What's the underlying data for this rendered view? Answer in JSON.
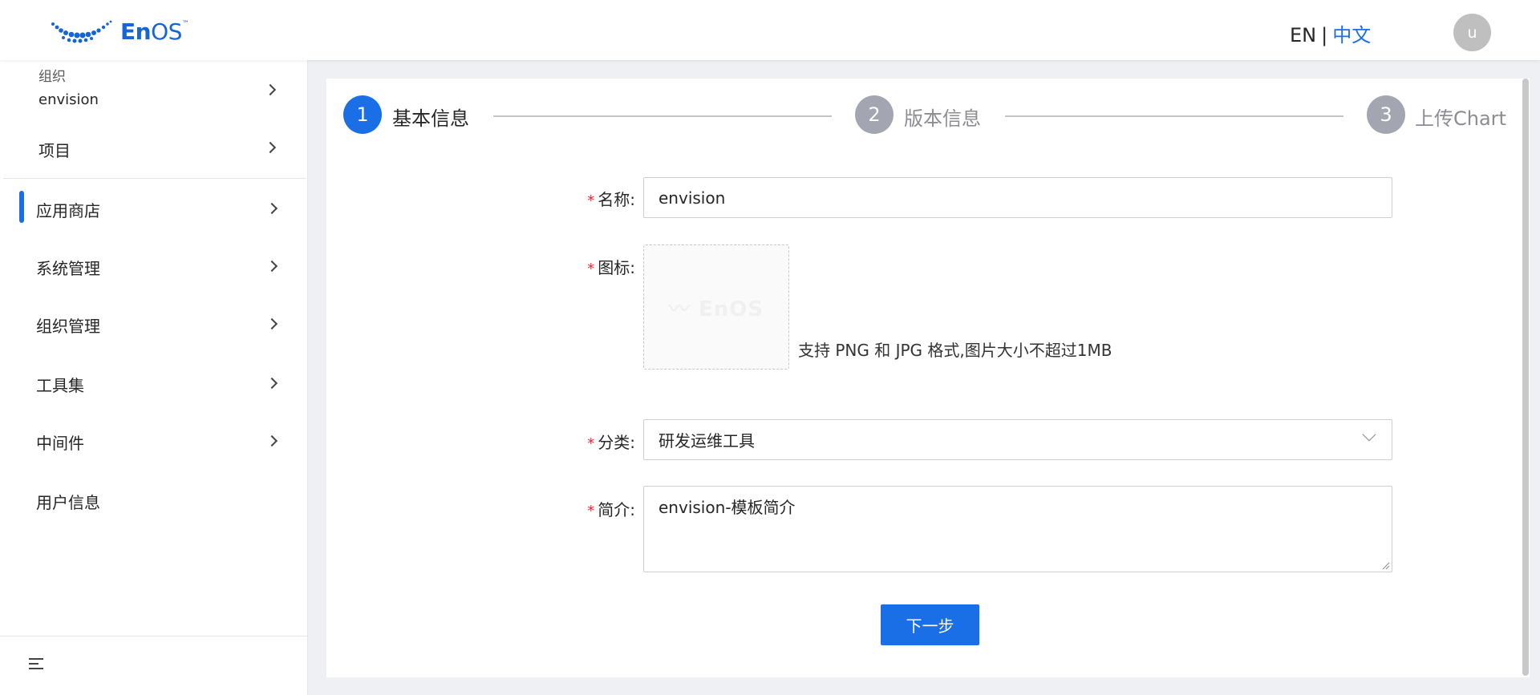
{
  "header": {
    "logo_text_bold": "En",
    "logo_text_regular": "OS",
    "logo_tm": "™",
    "lang_en": "EN",
    "lang_sep": "|",
    "lang_zh": "中文",
    "avatar_letter": "u"
  },
  "sidebar": {
    "org_caption": "组织",
    "org_name": "envision",
    "project_label": "项目",
    "items": [
      {
        "label": "应用商店",
        "active": true,
        "has_arrow": true
      },
      {
        "label": "系统管理",
        "active": false,
        "has_arrow": true
      },
      {
        "label": "组织管理",
        "active": false,
        "has_arrow": true
      },
      {
        "label": "工具集",
        "active": false,
        "has_arrow": true
      },
      {
        "label": "中间件",
        "active": false,
        "has_arrow": true
      },
      {
        "label": "用户信息",
        "active": false,
        "has_arrow": false
      }
    ],
    "collapse_icon": "menu-collapse-icon"
  },
  "steps": [
    {
      "number": "1",
      "label": "基本信息",
      "state": "active"
    },
    {
      "number": "2",
      "label": "版本信息",
      "state": "idle"
    },
    {
      "number": "3",
      "label": "上传Chart",
      "state": "idle"
    }
  ],
  "form": {
    "required_mark": "*",
    "name_label": "名称:",
    "name_value": "envision",
    "icon_label": "图标:",
    "icon_hint": "支持 PNG 和 JPG 格式,图片大小不超过1MB",
    "category_label": "分类:",
    "category_value": "研发运维工具",
    "intro_label": "简介:",
    "intro_value": "envision-模板简介",
    "next_button": "下一步"
  },
  "colors": {
    "primary": "#1a6fe6",
    "step_idle": "#a3a6b1",
    "required": "#f5222d"
  }
}
